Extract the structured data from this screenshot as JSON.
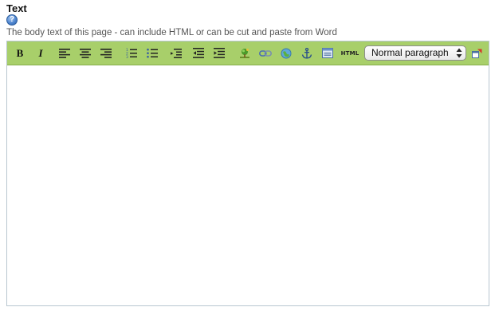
{
  "field": {
    "label": "Text",
    "help_glyph": "?",
    "description": "The body text of this page - can include HTML or can be cut and paste from Word"
  },
  "toolbar": {
    "bold_label": "B",
    "italic_label": "I",
    "html_label": "HTML",
    "format_select": {
      "selected": "Normal paragraph"
    },
    "icons": [
      "bold-icon",
      "italic-icon",
      "align-left-icon",
      "align-center-icon",
      "align-right-icon",
      "ordered-list-icon",
      "unordered-list-icon",
      "outdent-icon",
      "indent-left-icon",
      "indent-right-icon",
      "image-icon",
      "link-icon",
      "unlink-icon",
      "anchor-icon",
      "table-icon",
      "html-source-icon",
      "fullscreen-icon"
    ]
  },
  "colors": {
    "toolbar_bg": "#a8cf6a",
    "editor_border": "#b8c6d0",
    "help_icon": "#4f86cf"
  },
  "editor": {
    "content": ""
  }
}
